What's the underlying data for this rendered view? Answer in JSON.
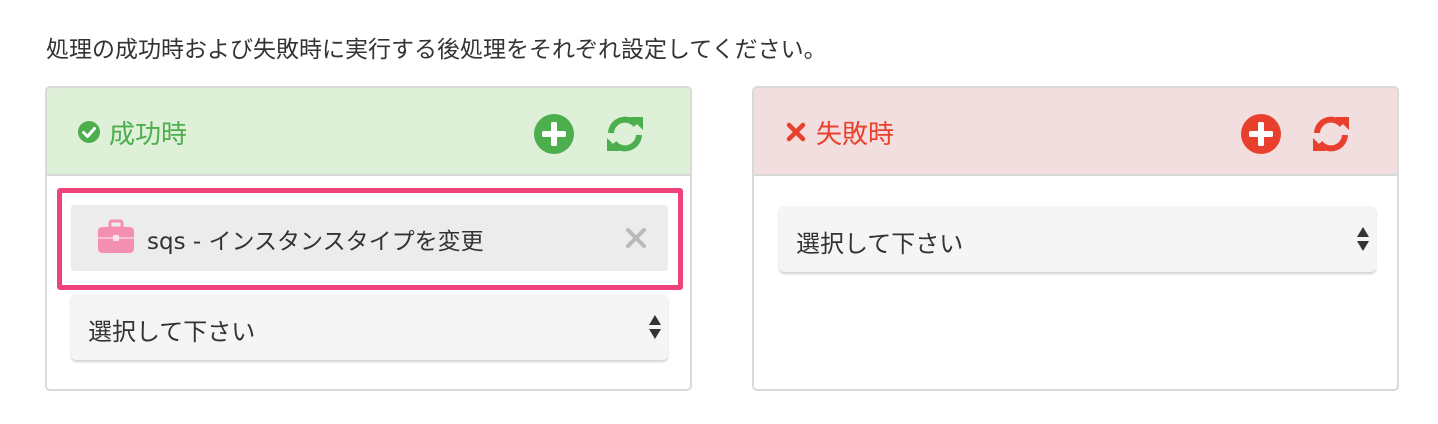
{
  "instruction": "処理の成功時および失敗時に実行する後処理をそれぞれ設定してください。",
  "colors": {
    "success": "#4cae4c",
    "success_bg": "#dff0d8",
    "failure": "#e8402d",
    "failure_bg": "#f2dede",
    "highlight": "#f0437a",
    "briefcase": "#f48fb1"
  },
  "success_panel": {
    "title": "成功時",
    "title_icon": "check-circle-icon",
    "add_icon": "plus-circle-icon",
    "refresh_icon": "refresh-icon",
    "actions": [
      {
        "icon": "briefcase-icon",
        "label": "sqs - インスタンスタイプを変更",
        "remove_icon": "close-icon"
      }
    ],
    "select": {
      "selected": "選択して下さい"
    }
  },
  "failure_panel": {
    "title": "失敗時",
    "title_icon": "times-icon",
    "add_icon": "plus-circle-icon",
    "refresh_icon": "refresh-icon",
    "select": {
      "selected": "選択して下さい"
    }
  }
}
